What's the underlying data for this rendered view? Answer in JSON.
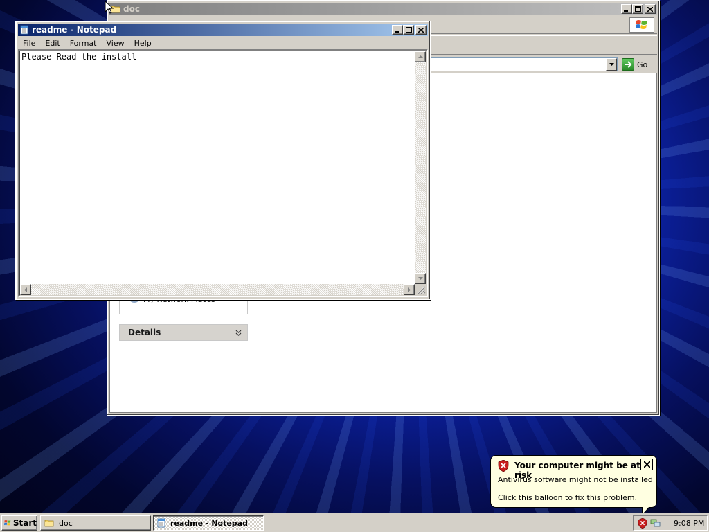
{
  "colors": {
    "active_title_start": "#0a246a",
    "active_title_end": "#a6caf0",
    "inactive_title_start": "#808080",
    "window_face": "#d4d0c8",
    "balloon_bg": "#ffffe1",
    "go_arrow": "#2a8a2a"
  },
  "explorer": {
    "title": "doc",
    "address_go_label": "Go",
    "network_places_label": "My Network Places",
    "details_label": "Details",
    "icons": [
      "folder-icon",
      "windows-logo-icon",
      "go-arrow-icon",
      "network-places-icon",
      "chevron-double-down-icon"
    ]
  },
  "notepad": {
    "title": "readme - Notepad",
    "menu": [
      "File",
      "Edit",
      "Format",
      "View",
      "Help"
    ],
    "content": "Please Read the install"
  },
  "taskbar": {
    "start_label": "Start",
    "tasks": [
      {
        "label": "doc",
        "icon": "folder-icon",
        "active": false
      },
      {
        "label": "readme - Notepad",
        "icon": "notepad-icon",
        "active": true
      }
    ],
    "tray_icons": [
      "security-alert-icon",
      "network-icon"
    ],
    "clock": "9:08 PM"
  },
  "balloon": {
    "title": "Your computer might be at risk",
    "line1": "Antivirus software might not be installed",
    "line2": "Click this balloon to fix this problem."
  }
}
